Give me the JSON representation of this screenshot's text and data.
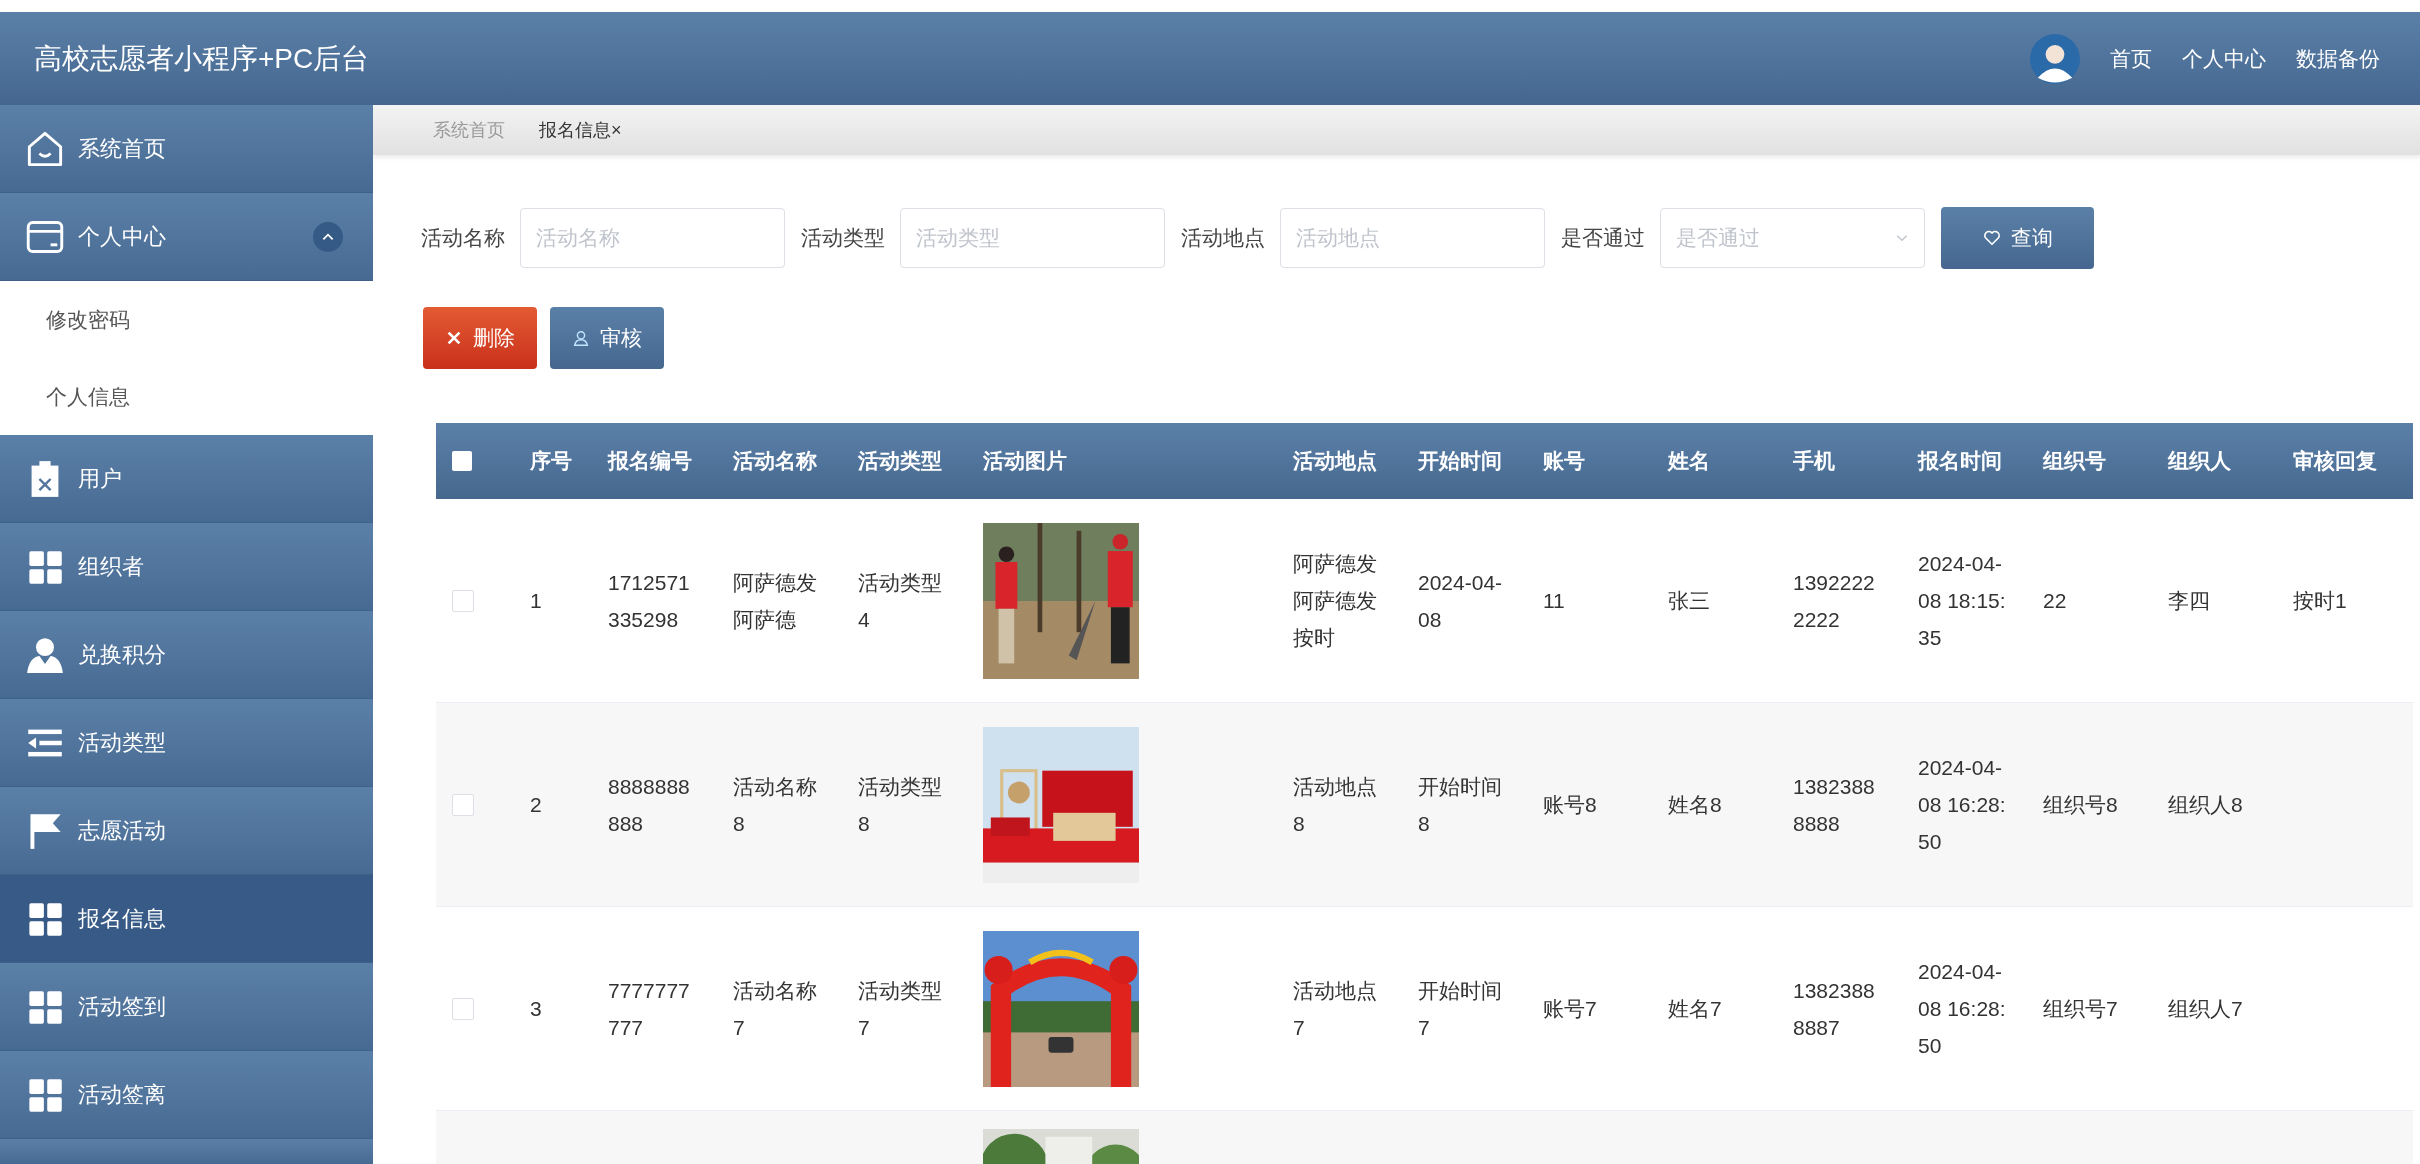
{
  "header": {
    "title": "高校志愿者小程序+PC后台",
    "nav": [
      "首页",
      "个人中心",
      "数据备份"
    ]
  },
  "sidebar": {
    "items": [
      {
        "label": "系统首页",
        "kind": "home",
        "selected": false
      },
      {
        "label": "个人中心",
        "kind": "card",
        "selected": false,
        "expanded": true,
        "children": [
          {
            "label": "修改密码",
            "selected": false
          },
          {
            "label": "个人信息",
            "selected": false
          }
        ]
      },
      {
        "label": "用户",
        "kind": "clipboard",
        "selected": false
      },
      {
        "label": "组织者",
        "kind": "grid",
        "selected": false
      },
      {
        "label": "兑换积分",
        "kind": "person",
        "selected": false
      },
      {
        "label": "活动类型",
        "kind": "list",
        "selected": false
      },
      {
        "label": "志愿活动",
        "kind": "flag",
        "selected": false
      },
      {
        "label": "报名信息",
        "kind": "grid",
        "selected": true
      },
      {
        "label": "活动签到",
        "kind": "grid",
        "selected": false
      },
      {
        "label": "活动签离",
        "kind": "grid",
        "selected": false
      }
    ]
  },
  "breadcrumb": [
    {
      "label": "系统首页",
      "selected": false
    },
    {
      "label": "报名信息×",
      "selected": true
    }
  ],
  "search": {
    "fields": [
      {
        "label": "活动名称",
        "placeholder": "活动名称",
        "kind": "input"
      },
      {
        "label": "活动类型",
        "placeholder": "活动类型",
        "kind": "input"
      },
      {
        "label": "活动地点",
        "placeholder": "活动地点",
        "kind": "input"
      },
      {
        "label": "是否通过",
        "placeholder": "是否通过",
        "kind": "select"
      }
    ],
    "button": "查询"
  },
  "actions": [
    {
      "label": "删除",
      "kind": "danger"
    },
    {
      "label": "审核",
      "kind": "primary"
    }
  ],
  "table": {
    "select_all": {
      "checked": false
    },
    "columns": [
      "序号",
      "报名编号",
      "活动名称",
      "活动类型",
      "活动图片",
      "活动地点",
      "开始时间",
      "账号",
      "姓名",
      "手机",
      "报名时间",
      "组织号",
      "组织人",
      "审核回复"
    ],
    "rows": [
      {
        "checked": false,
        "index": "1",
        "reg_no": "1712571335298",
        "activity_name": "阿萨德发阿萨德",
        "activity_type": "活动类型4",
        "image": {
          "kind": "picture"
        },
        "location": "阿萨德发阿萨德发按时",
        "start_time": "2024-04-08",
        "account": "11",
        "name": "张三",
        "phone": "13922222222",
        "reg_time": "2024-04-08 18:15:35",
        "org_no": "22",
        "organizer": "李四",
        "reply": "按时1"
      },
      {
        "checked": false,
        "index": "2",
        "reg_no": "8888888888",
        "activity_name": "活动名称8",
        "activity_type": "活动类型8",
        "image": {
          "kind": "picture"
        },
        "location": "活动地点8",
        "start_time": "开始时间8",
        "account": "账号8",
        "name": "姓名8",
        "phone": "13823888888",
        "reg_time": "2024-04-08 16:28:50",
        "org_no": "组织号8",
        "organizer": "组织人8"
      },
      {
        "checked": false,
        "index": "3",
        "reg_no": "7777777777",
        "activity_name": "活动名称7",
        "activity_type": "活动类型7",
        "image": {
          "kind": "picture"
        },
        "location": "活动地点7",
        "start_time": "开始时间7",
        "account": "账号7",
        "name": "姓名7",
        "phone": "13823888887",
        "reg_time": "2024-04-08 16:28:50",
        "org_no": "组织号7",
        "organizer": "组织人7"
      },
      {
        "image": {
          "kind": "picture"
        }
      }
    ]
  }
}
